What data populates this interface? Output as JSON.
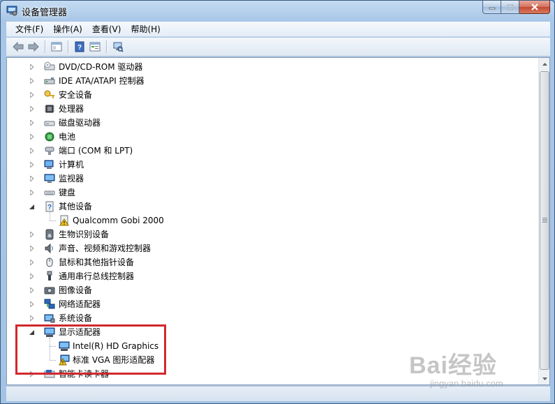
{
  "window": {
    "title": "设备管理器"
  },
  "menu": {
    "items": [
      "文件(F)",
      "操作(A)",
      "查看(V)",
      "帮助(H)"
    ]
  },
  "tree": {
    "items": [
      {
        "label": "DVD/CD-ROM 驱动器",
        "icon": "dvd-drive-icon",
        "expanded": false
      },
      {
        "label": "IDE ATA/ATAPI 控制器",
        "icon": "ide-controller-icon",
        "expanded": false
      },
      {
        "label": "安全设备",
        "icon": "security-key-icon",
        "expanded": false
      },
      {
        "label": "处理器",
        "icon": "processor-icon",
        "expanded": false
      },
      {
        "label": "磁盘驱动器",
        "icon": "disk-drive-icon",
        "expanded": false
      },
      {
        "label": "电池",
        "icon": "battery-icon",
        "expanded": false
      },
      {
        "label": "端口 (COM 和 LPT)",
        "icon": "port-icon",
        "expanded": false
      },
      {
        "label": "计算机",
        "icon": "computer-icon",
        "expanded": false
      },
      {
        "label": "监视器",
        "icon": "monitor-icon",
        "expanded": false
      },
      {
        "label": "键盘",
        "icon": "keyboard-icon",
        "expanded": false
      },
      {
        "label": "其他设备",
        "icon": "unknown-device-icon",
        "expanded": true
      },
      {
        "label": "Qualcomm Gobi 2000",
        "icon": "warning-device-icon",
        "child": true
      },
      {
        "label": "生物识别设备",
        "icon": "fingerprint-icon",
        "expanded": false
      },
      {
        "label": "声音、视频和游戏控制器",
        "icon": "speaker-icon",
        "expanded": false
      },
      {
        "label": "鼠标和其他指针设备",
        "icon": "mouse-icon",
        "expanded": false
      },
      {
        "label": "通用串行总线控制器",
        "icon": "usb-icon",
        "expanded": false
      },
      {
        "label": "图像设备",
        "icon": "camera-icon",
        "expanded": false
      },
      {
        "label": "网络适配器",
        "icon": "network-icon",
        "expanded": false
      },
      {
        "label": "系统设备",
        "icon": "system-device-icon",
        "expanded": false
      },
      {
        "label": "显示适配器",
        "icon": "display-adapter-icon",
        "expanded": true
      },
      {
        "label": "Intel(R) HD Graphics",
        "icon": "display-adapter-icon",
        "child": true
      },
      {
        "label": "标准 VGA 图形适配器",
        "icon": "warning-display-icon",
        "child": true
      },
      {
        "label": "智能卡读卡器",
        "icon": "smart-card-reader-icon",
        "expanded": false
      }
    ]
  },
  "watermark": {
    "brand": "Bai经验",
    "sub": "jingyan.baidu.com"
  },
  "colors": {
    "highlight": "#d1282e",
    "accent": "#1f5fb8"
  }
}
